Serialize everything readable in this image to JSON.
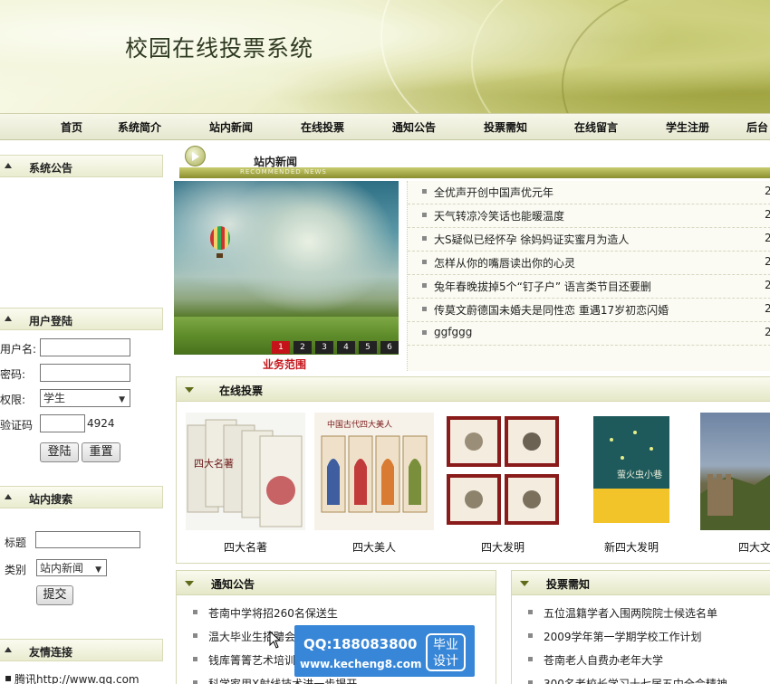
{
  "header": {
    "title": "校园在线投票系统"
  },
  "nav": {
    "items": [
      "首页",
      "系统简介",
      "站内新闻",
      "在线投票",
      "通知公告",
      "投票需知",
      "在线留言",
      "学生注册",
      "后台"
    ]
  },
  "sidebar": {
    "announcement": {
      "title": "系统公告"
    },
    "login": {
      "title": "用户登陆",
      "username_label": "用户名:",
      "password_label": "密码:",
      "role_label": "权限:",
      "role_value": "学生",
      "captcha_label": "验证码",
      "captcha_code": "4924",
      "login_button": "登陆",
      "reset_button": "重置"
    },
    "search": {
      "title": "站内搜索",
      "title_label": "标题",
      "category_label": "类别",
      "category_value": "站内新闻",
      "submit_button": "提交"
    },
    "links": {
      "title": "友情连接",
      "first_link": "腾讯http://www.qq.com"
    }
  },
  "news": {
    "title": "站内新闻",
    "subtitle": "RECOMMENDED NEWS",
    "slide_caption": "业务范围",
    "pages": [
      "1",
      "2",
      "3",
      "4",
      "5",
      "6"
    ],
    "active_page": 1,
    "items": [
      {
        "title": "全优声开创中国声优元年",
        "date": "2"
      },
      {
        "title": "天气转凉冷笑话也能暖温度",
        "date": "2"
      },
      {
        "title": "大S疑似已经怀孕 徐妈妈证实蜜月为造人",
        "date": "2"
      },
      {
        "title": "怎样从你的嘴唇读出你的心灵",
        "date": "2"
      },
      {
        "title": "兔年春晚拔掉5个“钉子户” 语言类节目还要删",
        "date": "2"
      },
      {
        "title": "传莫文蔚德国未婚夫是同性恋 重遇17岁初恋闪婚",
        "date": "2"
      },
      {
        "title": "ggfggg",
        "date": "2"
      }
    ]
  },
  "vote": {
    "title": "在线投票",
    "items": [
      {
        "label": "四大名著",
        "image_text": "四大名著"
      },
      {
        "label": "四大美人",
        "image_text": "中国古代四大美人"
      },
      {
        "label": "四大发明",
        "image_text": ""
      },
      {
        "label": "新四大发明",
        "image_text": "萤火虫小巷"
      },
      {
        "label": "四大文明",
        "image_text": ""
      }
    ]
  },
  "notice": {
    "title": "通知公告",
    "items": [
      "苍南中学将招260名保送生",
      "温大毕业生招聘会",
      "钱库箐箐艺术培训",
      "科学家用X射线技术进一步揭开"
    ]
  },
  "voting_rules": {
    "title": "投票需知",
    "items": [
      "五位温籍学者入围两院院士候选名单",
      "2009学年第一学期学校工作计划",
      "苍南老人自费办老年大学",
      "300名老校长学习十七届五中全会精神"
    ]
  },
  "watermark": {
    "qq": "QQ:188083800",
    "site": "www.kecheng8.com",
    "badge_line1": "毕业",
    "badge_line2": "设计"
  },
  "colors": {
    "accent": "#c4141a",
    "header_bar": "#8a8e2e",
    "watermark": "#267cd4"
  }
}
